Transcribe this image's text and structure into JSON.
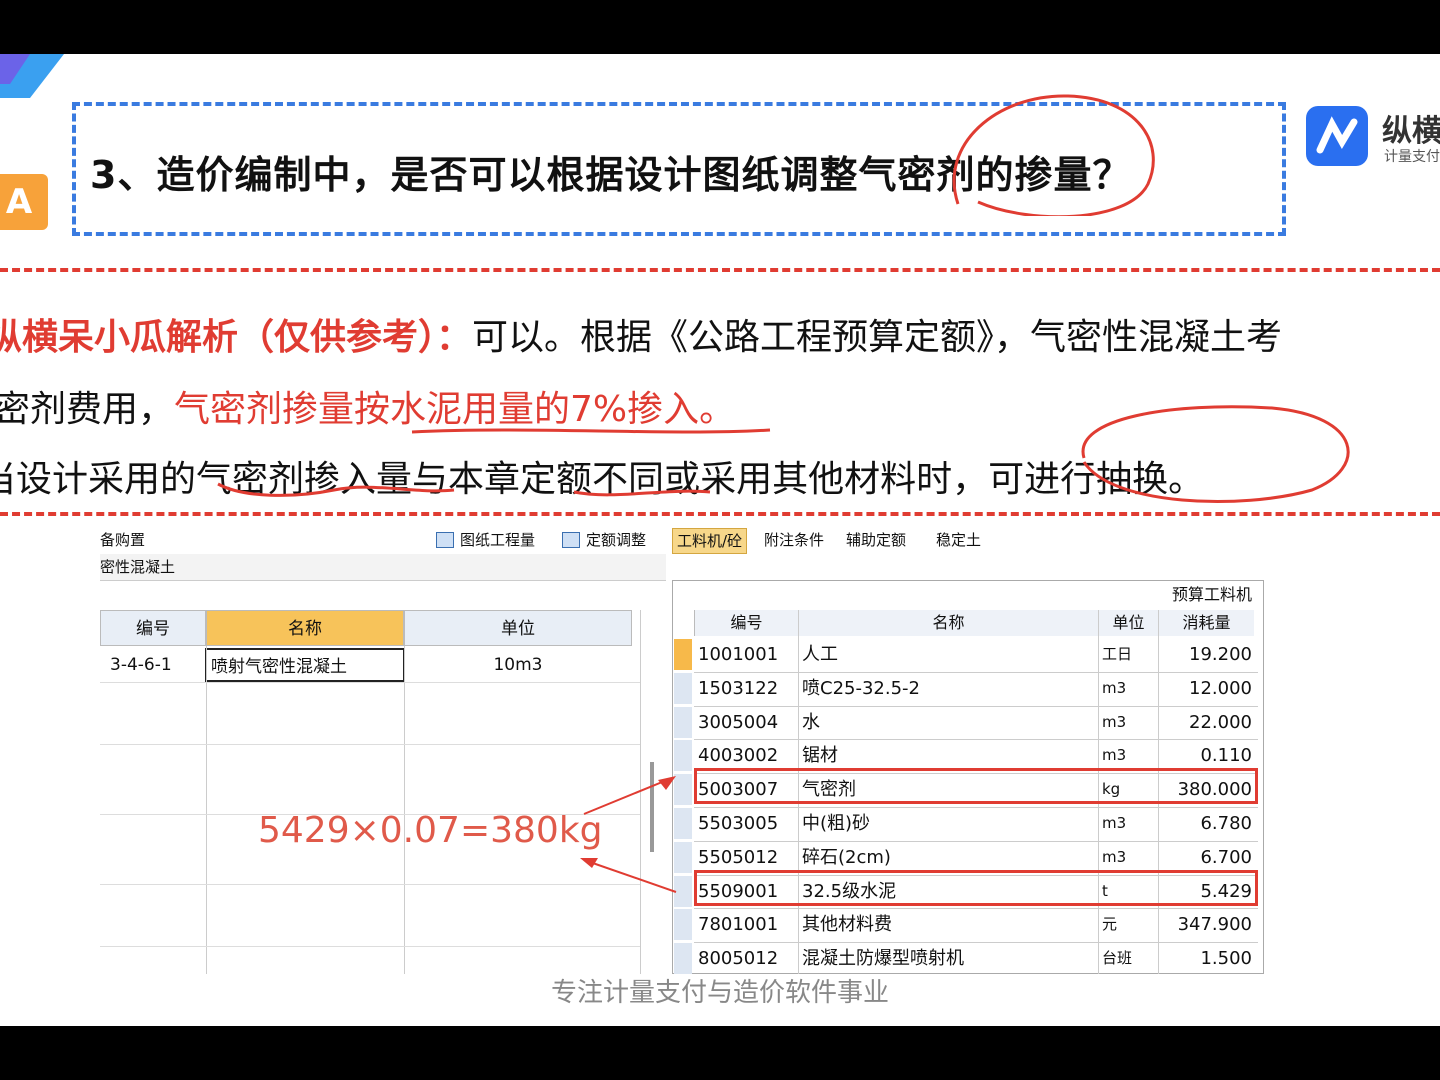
{
  "question": {
    "badge": "A",
    "text": "3、造价编制中，是否可以根据设计图纸调整气密剂的掺量？"
  },
  "brand": {
    "name": "纵横",
    "sub": "计量支付"
  },
  "analysis": {
    "label": "纵横呆小瓜解析（仅供参考）：",
    "line1_rest": "可以。根据《公路工程预算定额》，气密性混凝土考",
    "line2_a": "密剂费用，",
    "line2_b": "气密剂掺量按水泥用量的7%掺入。",
    "line3_a": "当设计采用的",
    "line3_b": "气密剂掺入量",
    "line3_c": "与本章",
    "line3_d": "定额不同",
    "line3_e": "或采用其他材料时，",
    "line3_f": "可进行抽换。"
  },
  "formula": "5429×0.07=380kg",
  "footer": "专注计量支付与造价软件事业",
  "software": {
    "left_top": "备购置",
    "toolbar": {
      "drawing_qty": "图纸工程量",
      "quota_adjust": "定额调整"
    },
    "category": "密性混凝土",
    "left_headers": {
      "code": "编号",
      "name": "名称",
      "unit": "单位"
    },
    "left_row": {
      "code": "3-4-6-1",
      "name": "喷射气密性混凝土",
      "unit": "10m3"
    },
    "tabs": [
      "工料机/砼",
      "附注条件",
      "辅助定额",
      "稳定土"
    ],
    "right_title": "预算工料机",
    "right_headers": {
      "code": "编号",
      "name": "名称",
      "unit": "单位",
      "qty": "消耗量"
    },
    "rows": [
      {
        "code": "1001001",
        "name": "人工",
        "unit": "工日",
        "qty": "19.200"
      },
      {
        "code": "1503122",
        "name": "喷C25-32.5-2",
        "unit": "m3",
        "qty": "12.000"
      },
      {
        "code": "3005004",
        "name": "水",
        "unit": "m3",
        "qty": "22.000"
      },
      {
        "code": "4003002",
        "name": "锯材",
        "unit": "m3",
        "qty": "0.110"
      },
      {
        "code": "5003007",
        "name": "气密剂",
        "unit": "kg",
        "qty": "380.000"
      },
      {
        "code": "5503005",
        "name": "中(粗)砂",
        "unit": "m3",
        "qty": "6.780"
      },
      {
        "code": "5505012",
        "name": "碎石(2cm)",
        "unit": "m3",
        "qty": "6.700"
      },
      {
        "code": "5509001",
        "name": "32.5级水泥",
        "unit": "t",
        "qty": "5.429"
      },
      {
        "code": "7801001",
        "name": "其他材料费",
        "unit": "元",
        "qty": "347.900"
      },
      {
        "code": "8005012",
        "name": "混凝土防爆型喷射机",
        "unit": "台班",
        "qty": "1.500"
      }
    ]
  },
  "colors": {
    "accent_blue": "#3a7be0",
    "accent_red": "#e03c32",
    "badge_orange": "#f7a23a"
  }
}
